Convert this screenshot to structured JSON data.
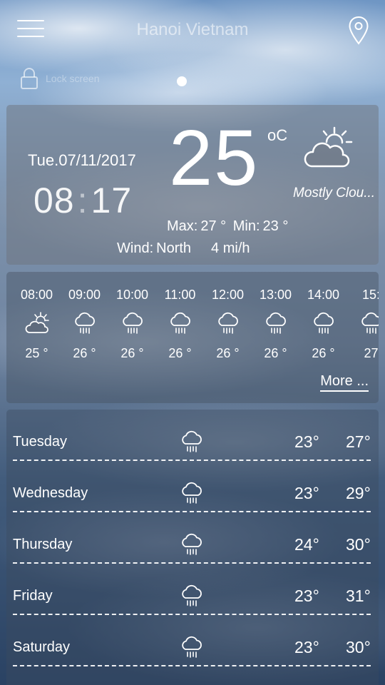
{
  "header": {
    "city": "Hanoi Vietnam",
    "lock_label": "Lock screen"
  },
  "current": {
    "date": "Tue.07/11/2017",
    "time_hour": "08",
    "time_sep": ":",
    "time_min": "17",
    "temperature": "25",
    "unit": "oC",
    "condition": "Mostly Clou...",
    "max_label": "Max:",
    "max_value": "27 °",
    "min_label": "Min:",
    "min_value": "23 °",
    "wind_label": "Wind:",
    "wind_dir": "North",
    "wind_speed": "4 mi/h",
    "icon": "partly-sunny-icon"
  },
  "hourly": [
    {
      "time": "08:00",
      "temp": "25 °",
      "icon": "partly-sunny-icon"
    },
    {
      "time": "09:00",
      "temp": "26 °",
      "icon": "rain-icon"
    },
    {
      "time": "10:00",
      "temp": "26 °",
      "icon": "rain-icon"
    },
    {
      "time": "11:00",
      "temp": "26 °",
      "icon": "rain-icon"
    },
    {
      "time": "12:00",
      "temp": "26 °",
      "icon": "rain-icon"
    },
    {
      "time": "13:00",
      "temp": "26 °",
      "icon": "rain-icon"
    },
    {
      "time": "14:00",
      "temp": "26 °",
      "icon": "rain-icon"
    },
    {
      "time": "15:",
      "temp": "27",
      "icon": "rain-icon"
    }
  ],
  "more_label": "More ...",
  "daily": [
    {
      "day": "Tuesday",
      "min": "23°",
      "max": "27°",
      "icon": "rain-icon"
    },
    {
      "day": "Wednesday",
      "min": "23°",
      "max": "29°",
      "icon": "rain-icon"
    },
    {
      "day": "Thursday",
      "min": "24°",
      "max": "30°",
      "icon": "rain-icon"
    },
    {
      "day": "Friday",
      "min": "23°",
      "max": "31°",
      "icon": "rain-icon"
    },
    {
      "day": "Saturday",
      "min": "23°",
      "max": "30°",
      "icon": "rain-icon"
    }
  ]
}
